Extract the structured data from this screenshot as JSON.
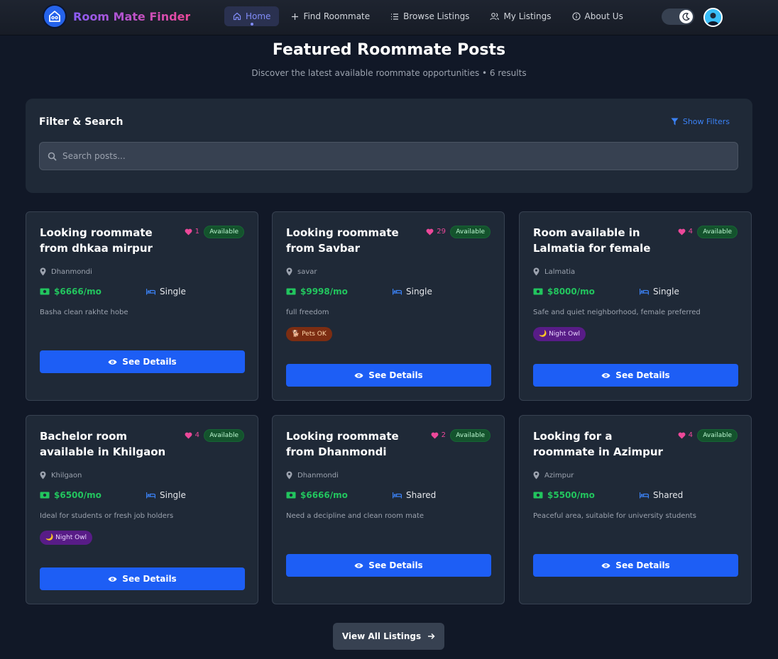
{
  "nav": {
    "brand": "Room Mate Finder",
    "links": [
      {
        "label": "Home",
        "icon": "home-icon",
        "active": true
      },
      {
        "label": "Find Roommate",
        "icon": "plus-icon",
        "active": false
      },
      {
        "label": "Browse Listings",
        "icon": "list-icon",
        "active": false
      },
      {
        "label": "My Listings",
        "icon": "users-icon",
        "active": false
      },
      {
        "label": "About Us",
        "icon": "info-icon",
        "active": false
      }
    ]
  },
  "header": {
    "title": "Featured Roommate Posts",
    "subtitle": "Discover the latest available roommate opportunities • 6 results"
  },
  "filter": {
    "title": "Filter & Search",
    "toggle_label": "Show Filters",
    "search_placeholder": "Search posts..."
  },
  "posts": [
    {
      "title": "Looking roommate from dhkaa mirpur",
      "likes": "1",
      "status": "Available",
      "location": "Dhanmondi",
      "rent": "$6666/mo",
      "room_type": "Single",
      "description": "Basha clean rakhte hobe",
      "tag": "",
      "button": "See Details"
    },
    {
      "title": "Looking roommate from Savbar",
      "likes": "29",
      "status": "Available",
      "location": "savar",
      "rent": "$9998/mo",
      "room_type": "Single",
      "description": "full freedom",
      "tag": "🐕 Pets OK",
      "button": "See Details"
    },
    {
      "title": "Room available in Lalmatia for female",
      "likes": "4",
      "status": "Available",
      "location": "Lalmatia",
      "rent": "$8000/mo",
      "room_type": "Single",
      "description": "Safe and quiet neighborhood, female preferred",
      "tag": "🌙 Night Owl",
      "button": "See Details"
    },
    {
      "title": "Bachelor room available in Khilgaon",
      "likes": "4",
      "status": "Available",
      "location": "Khilgaon",
      "rent": "$6500/mo",
      "room_type": "Single",
      "description": "Ideal for students or fresh job holders",
      "tag": "🌙 Night Owl",
      "button": "See Details"
    },
    {
      "title": "Looking roommate from Dhanmondi",
      "likes": "2",
      "status": "Available",
      "location": "Dhanmondi",
      "rent": "$6666/mo",
      "room_type": "Shared",
      "description": "Need a decipline and clean room mate",
      "tag": "",
      "button": "See Details"
    },
    {
      "title": "Looking for a roommate in Azimpur",
      "likes": "4",
      "status": "Available",
      "location": "Azimpur",
      "rent": "$5500/mo",
      "room_type": "Shared",
      "description": "Peaceful area, suitable for university students",
      "tag": "",
      "button": "See Details"
    }
  ],
  "footer": {
    "view_all": "View All Listings"
  },
  "colors": {
    "background": "#111827",
    "card": "#1f2937",
    "primary": "#1d5ef5",
    "price": "#22c55e",
    "likes": "#ec4899",
    "brand_start": "#8b5cf6",
    "brand_end": "#ec4899"
  }
}
